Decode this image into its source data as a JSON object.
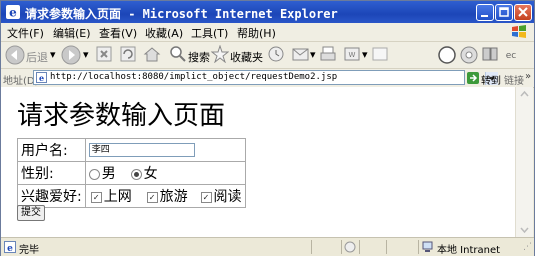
{
  "window": {
    "title": "请求参数输入页面 - Microsoft Internet Explorer"
  },
  "menu": {
    "items": [
      "文件(F)",
      "编辑(E)",
      "查看(V)",
      "收藏(A)",
      "工具(T)",
      "帮助(H)"
    ]
  },
  "toolbar": {
    "back_label": "后退",
    "search_label": "搜索",
    "favorites_label": "收藏夹"
  },
  "address": {
    "label": "地址(D)",
    "url": "http://localhost:8080/implict_object/requestDemo2.jsp",
    "go_label": "转到",
    "links_label": "链接"
  },
  "page": {
    "heading": "请求参数输入页面",
    "username_label": "用户名:",
    "username_value": "李四",
    "gender_label": "性别:",
    "gender_male": "男",
    "gender_female": "女",
    "gender_selected": "女",
    "hobby_label": "兴趣爱好:",
    "hobbies": [
      "上网",
      "旅游",
      "阅读"
    ],
    "submit_label": "提交"
  },
  "status": {
    "text": "完毕",
    "zone": "本地 Intranet"
  }
}
